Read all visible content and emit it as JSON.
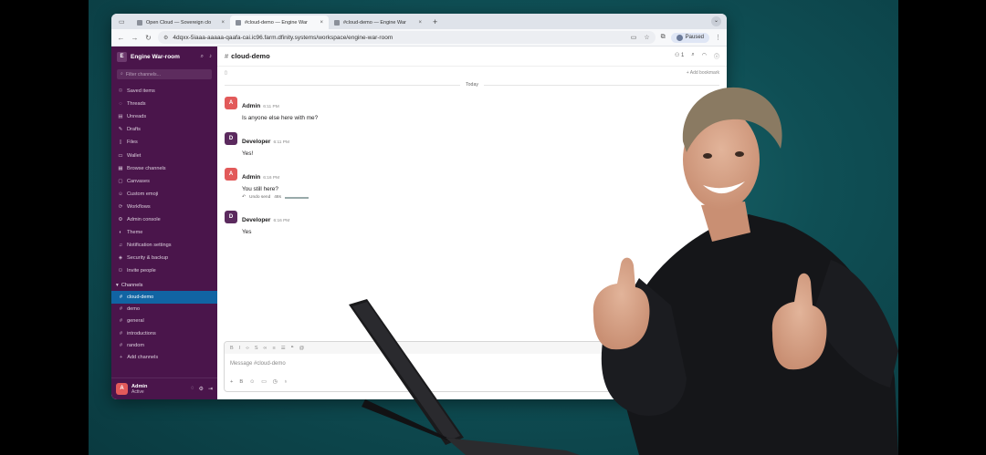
{
  "browser": {
    "tabs": [
      {
        "title": "Open Cloud — Sovereign clo",
        "active": false
      },
      {
        "title": "#cloud-demo — Engine War",
        "active": true
      },
      {
        "title": "#cloud-demo — Engine War",
        "active": false
      }
    ],
    "new_tab": "+",
    "url": "4dqxx-5iaaa-aaaaa-qaafa-cai.ic96.farm.dfinity.systems/workspace/engine-war-room",
    "profile_status": "Paused"
  },
  "sidebar": {
    "workspace_name": "Engine War-room",
    "workspace_initial": "E",
    "filter_placeholder": "Filter channels...",
    "items": [
      {
        "label": "Saved items",
        "icon": "bookmark-icon"
      },
      {
        "label": "Threads",
        "icon": "thread-icon"
      },
      {
        "label": "Unreads",
        "icon": "unreads-icon"
      },
      {
        "label": "Drafts",
        "icon": "draft-icon"
      },
      {
        "label": "Files",
        "icon": "file-icon"
      },
      {
        "label": "Wallet",
        "icon": "wallet-icon"
      },
      {
        "label": "Browse channels",
        "icon": "browse-icon"
      },
      {
        "label": "Canvases",
        "icon": "canvas-icon"
      },
      {
        "label": "Custom emoji",
        "icon": "emoji-icon"
      },
      {
        "label": "Workflows",
        "icon": "workflow-icon"
      },
      {
        "label": "Admin console",
        "icon": "admin-icon"
      },
      {
        "label": "Theme",
        "icon": "theme-icon"
      },
      {
        "label": "Notification settings",
        "icon": "bell-icon"
      },
      {
        "label": "Security & backup",
        "icon": "shield-icon"
      },
      {
        "label": "Invite people",
        "icon": "invite-icon"
      }
    ],
    "channels_heading": "Channels",
    "channels": [
      {
        "name": "cloud-demo",
        "active": true
      },
      {
        "name": "demo",
        "active": false
      },
      {
        "name": "general",
        "active": false
      },
      {
        "name": "introductions",
        "active": false
      },
      {
        "name": "random",
        "active": false
      }
    ],
    "add_channels": "Add channels",
    "user": {
      "name": "Admin",
      "status": "Active",
      "initial": "A"
    }
  },
  "channel": {
    "name": "cloud-demo",
    "member_count": "1",
    "add_bookmark": "+ Add bookmark",
    "date_divider": "Today"
  },
  "messages": [
    {
      "author": "Admin",
      "initial": "A",
      "time": "6:11 PM",
      "text": "Is anyone else here with me?",
      "color": "#e25a5a"
    },
    {
      "author": "Developer",
      "initial": "D",
      "time": "6:11 PM",
      "text": "Yes!",
      "color": "#5b2a5e"
    },
    {
      "author": "Admin",
      "initial": "A",
      "time": "6:16 PM",
      "text": "You still here?",
      "color": "#e25a5a",
      "undo": "Undo send",
      "undo_count": "48s"
    },
    {
      "author": "Developer",
      "initial": "D",
      "time": "6:16 PM",
      "text": "Yes",
      "color": "#5b2a5e"
    }
  ],
  "composer": {
    "placeholder": "Message #cloud-demo"
  },
  "colors": {
    "sidebar_bg": "#4a154b",
    "active_channel": "#1164a3",
    "backdrop": "#0f4f55"
  }
}
